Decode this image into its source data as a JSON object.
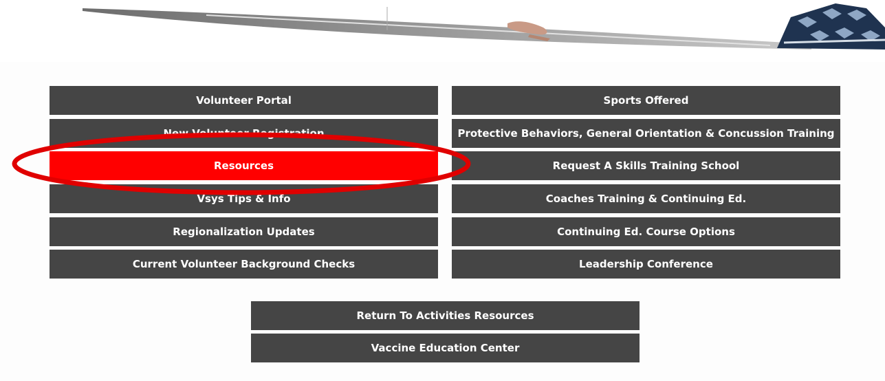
{
  "left_buttons": [
    {
      "label": "Volunteer Portal"
    },
    {
      "label": "New Volunteer Registration"
    },
    {
      "label": "Resources"
    },
    {
      "label": "Vsys Tips & Info"
    },
    {
      "label": "Regionalization Updates"
    },
    {
      "label": "Current Volunteer Background Checks"
    }
  ],
  "right_buttons": [
    {
      "label": "Sports Offered"
    },
    {
      "label": "Protective Behaviors, General Orientation & Concussion Training"
    },
    {
      "label": "Request A Skills Training School"
    },
    {
      "label": "Coaches Training & Continuing Ed."
    },
    {
      "label": "Continuing Ed. Course Options"
    },
    {
      "label": "Leadership Conference"
    }
  ],
  "bottom_buttons": [
    {
      "label": "Return To Activities Resources"
    },
    {
      "label": "Vaccine Education Center"
    }
  ],
  "colors": {
    "button_bg": "#454545",
    "active_bg": "#ff0000",
    "annotation": "#e00000"
  }
}
